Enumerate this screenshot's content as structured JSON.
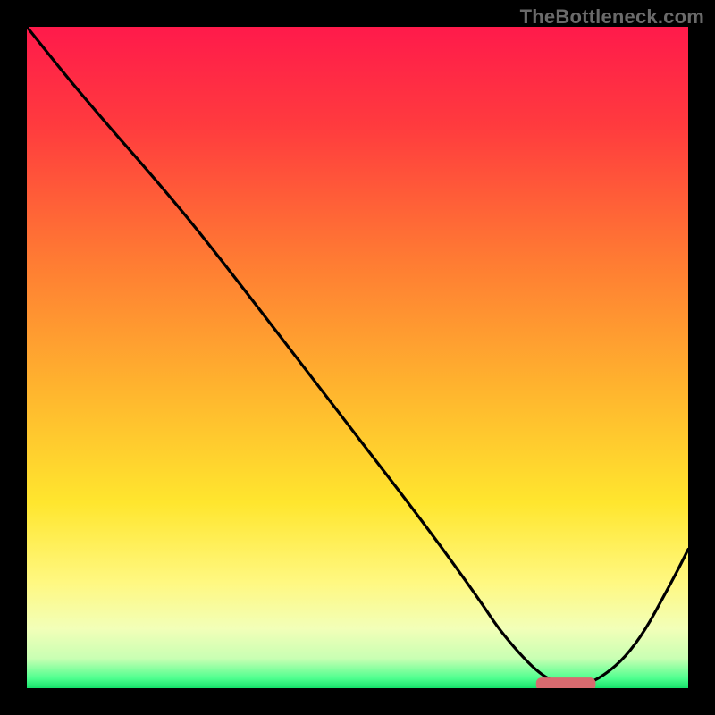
{
  "watermark": "TheBottleneck.com",
  "colors": {
    "frame": "#000000",
    "curve": "#000000",
    "marker": "#d86a6f",
    "gradient_stops": [
      {
        "offset": 0.0,
        "color": "#ff1a4b"
      },
      {
        "offset": 0.15,
        "color": "#ff3b3e"
      },
      {
        "offset": 0.35,
        "color": "#ff7a33"
      },
      {
        "offset": 0.55,
        "color": "#ffb52e"
      },
      {
        "offset": 0.72,
        "color": "#ffe62e"
      },
      {
        "offset": 0.84,
        "color": "#fff881"
      },
      {
        "offset": 0.91,
        "color": "#f2ffb8"
      },
      {
        "offset": 0.955,
        "color": "#c9ffb3"
      },
      {
        "offset": 0.985,
        "color": "#4fff8f"
      },
      {
        "offset": 1.0,
        "color": "#16e06a"
      }
    ]
  },
  "chart_data": {
    "type": "line",
    "title": "",
    "xlabel": "",
    "ylabel": "",
    "xlim": [
      0,
      100
    ],
    "ylim": [
      0,
      100
    ],
    "grid": false,
    "legend": false,
    "series": [
      {
        "name": "bottleneck-curve",
        "x": [
          0,
          8,
          22,
          30,
          40,
          50,
          60,
          68,
          72,
          78,
          82,
          86,
          92,
          98,
          100
        ],
        "values": [
          100,
          90,
          74,
          64,
          51,
          38,
          25,
          14,
          8,
          1.5,
          0.5,
          0.8,
          6,
          17,
          21
        ]
      }
    ],
    "annotations": [
      {
        "name": "optimal-marker",
        "shape": "rounded-bar",
        "x_start": 77,
        "x_end": 86,
        "y": 0.6,
        "height": 2.0
      }
    ]
  }
}
